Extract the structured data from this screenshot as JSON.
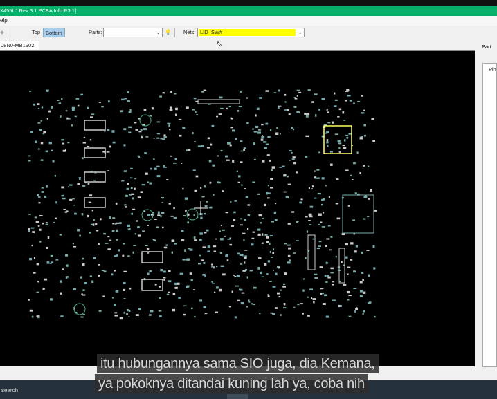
{
  "window": {
    "title": "X455LJ Rev:3.1 PCBA Info:R3.1]"
  },
  "menu": {
    "help": "elp"
  },
  "toolbar": {
    "top": "Top",
    "bottom": "Bottom",
    "parts_label": "Parts:",
    "parts_value": "",
    "nets_label": "Nets:",
    "nets_value": "LID_SW#"
  },
  "tab": {
    "label": "08N0-MB1902"
  },
  "right_panel": {
    "tab": "Part",
    "column": "Pin"
  },
  "taskbar": {
    "search": "search"
  },
  "subtitles": [
    "itu hubungannya sama SIO juga, dia Kemana,",
    "ya pokoknya ditandai kuning lah ya, coba nih"
  ],
  "colors": {
    "title_bar": "#05b06a",
    "highlight": "#ffff00",
    "board_bg": "#000000"
  }
}
